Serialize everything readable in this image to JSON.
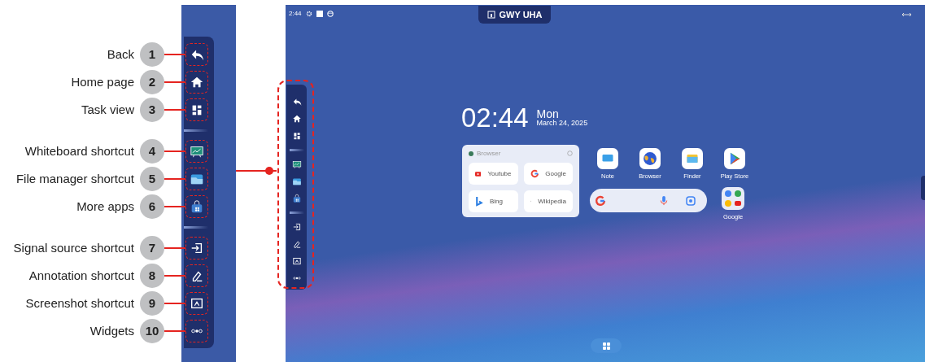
{
  "toolbar": [
    {
      "kind": "back",
      "callout": {
        "number": "1",
        "label": "Back"
      }
    },
    {
      "kind": "home",
      "callout": {
        "number": "2",
        "label": "Home page"
      }
    },
    {
      "kind": "tasks",
      "callout": {
        "number": "3",
        "label": "Task view"
      }
    },
    {
      "kind": "divider"
    },
    {
      "kind": "whiteboard",
      "callout": {
        "number": "4",
        "label": "Whiteboard shortcut"
      }
    },
    {
      "kind": "files",
      "callout": {
        "number": "5",
        "label": "File manager shortcut"
      }
    },
    {
      "kind": "apps",
      "callout": {
        "number": "6",
        "label": "More apps"
      }
    },
    {
      "kind": "divider"
    },
    {
      "kind": "source",
      "callout": {
        "number": "7",
        "label": "Signal source shortcut"
      }
    },
    {
      "kind": "annotate",
      "callout": {
        "number": "8",
        "label": "Annotation shortcut"
      }
    },
    {
      "kind": "screenshot",
      "callout": {
        "number": "9",
        "label": "Screenshot shortcut"
      }
    },
    {
      "kind": "widgets",
      "callout": {
        "number": "10",
        "label": "Widgets"
      }
    }
  ],
  "screen": {
    "status_bar": {
      "time": "2:44"
    },
    "device_name": "GWY UHA",
    "clock": {
      "time": "02:44",
      "day": "Mon",
      "date": "March 24, 2025"
    },
    "browser_widget": {
      "title": "Browser",
      "links": [
        {
          "kind": "youtube",
          "label": "Youtube"
        },
        {
          "kind": "google",
          "label": "Google"
        },
        {
          "kind": "bing",
          "label": "Bing"
        },
        {
          "kind": "wikipedia",
          "label": "Wikipedia"
        }
      ]
    },
    "apps": [
      {
        "kind": "note",
        "label": "Note"
      },
      {
        "kind": "browser",
        "label": "Browser"
      },
      {
        "kind": "finder",
        "label": "Finder"
      },
      {
        "kind": "playstore",
        "label": "Play Store"
      }
    ],
    "folder": {
      "label": "Google"
    }
  }
}
